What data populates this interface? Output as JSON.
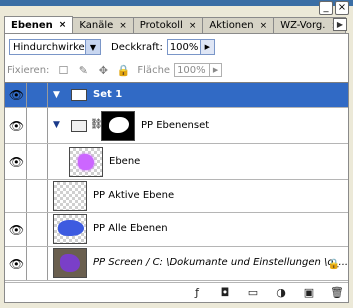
{
  "tabs": [
    {
      "label": "Ebenen",
      "active": true
    },
    {
      "label": "Kanäle",
      "active": false
    },
    {
      "label": "Protokoll",
      "active": false
    },
    {
      "label": "Aktionen",
      "active": false
    },
    {
      "label": "WZ-Vorg.",
      "active": false
    }
  ],
  "window_controls": {
    "minimize": "_",
    "close": "×"
  },
  "blend_mode": {
    "value": "Hindurchwirken"
  },
  "opacity": {
    "label": "Deckkraft:",
    "value": "100%"
  },
  "lock": {
    "label": "Fixieren:"
  },
  "fill": {
    "label": "Fläche",
    "value": "100%"
  },
  "layers": [
    {
      "name": "Set 1",
      "selected": true,
      "visible": true,
      "type": "set"
    },
    {
      "name": "PP Ebenenset",
      "selected": false,
      "visible": true,
      "type": "set-mask"
    },
    {
      "name": "Ebene",
      "selected": false,
      "visible": true,
      "type": "layer"
    },
    {
      "name": "PP Aktive Ebene",
      "selected": false,
      "visible": false,
      "type": "layer"
    },
    {
      "name": "PP Alle Ebenen",
      "selected": false,
      "visible": true,
      "type": "layer"
    },
    {
      "name": "PP Screen / C: \\Dokumante und Einstellungen \\o_...",
      "selected": false,
      "visible": true,
      "type": "layer-locked"
    }
  ],
  "colors": {
    "selection": "#316ac5",
    "tab_bg": "#ece9d8",
    "accent": "#3a6ea5"
  }
}
